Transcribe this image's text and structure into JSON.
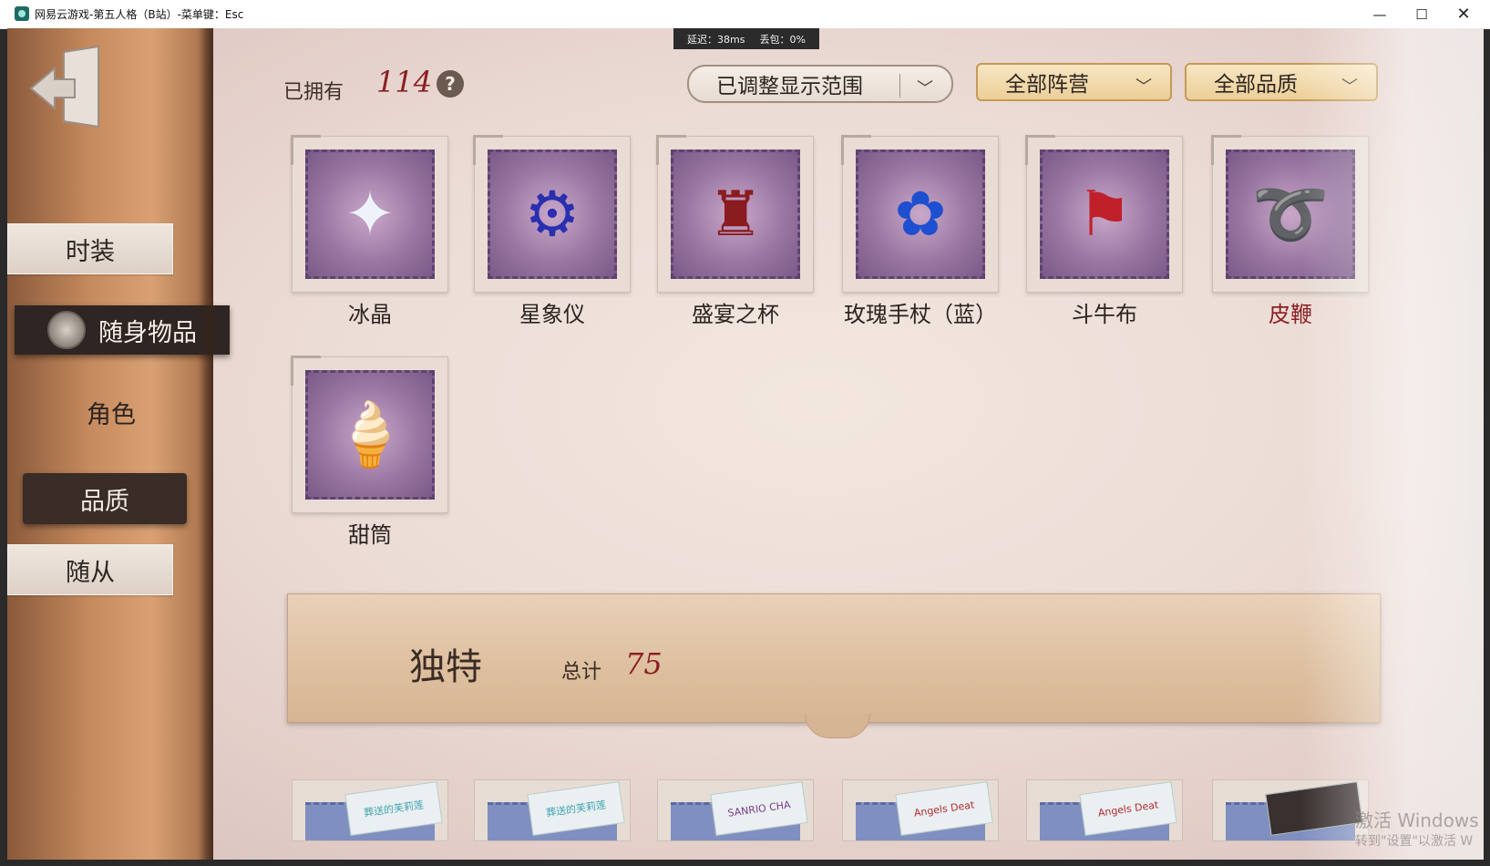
{
  "window": {
    "title": "网易云游戏-第五人格（B站）-菜单键：Esc",
    "minimize": "—",
    "maximize": "☐",
    "close": "✕"
  },
  "netstat": {
    "latency": "延迟：38ms",
    "packet_loss": "丢包：0%"
  },
  "sidebar": {
    "items": [
      {
        "label": "时装"
      },
      {
        "label": "随身物品"
      },
      {
        "label": "角色"
      },
      {
        "label": "品质"
      },
      {
        "label": "随从"
      }
    ]
  },
  "header": {
    "owned_label": "已拥有",
    "owned_count": "114",
    "help_glyph": "?",
    "filters": [
      {
        "label": "已调整显示范围"
      },
      {
        "label": "全部阵营"
      },
      {
        "label": "全部品质"
      }
    ]
  },
  "items": [
    {
      "name": "冰晶",
      "icon": "crystal-icon",
      "color": "#2c2420"
    },
    {
      "name": "星象仪",
      "icon": "astrolabe-icon",
      "color": "#2c2420"
    },
    {
      "name": "盛宴之杯",
      "icon": "goblet-icon",
      "color": "#2c2420"
    },
    {
      "name": "玫瑰手杖（蓝）",
      "icon": "rose-cane-icon",
      "color": "#2c2420"
    },
    {
      "name": "斗牛布",
      "icon": "bullfight-cape-icon",
      "color": "#2c2420"
    },
    {
      "name": "皮鞭",
      "icon": "whip-icon",
      "color": "#8b1f24"
    },
    {
      "name": "甜筒",
      "icon": "ice-cream-icon",
      "color": "#2c2420"
    }
  ],
  "category": {
    "title": "独特",
    "total_label": "总计",
    "total": "75"
  },
  "bottom_cards": [
    {
      "tag": "葬送的芙莉莲"
    },
    {
      "tag": "葬送的芙莉莲"
    },
    {
      "tag": "SANRIO CHA"
    },
    {
      "tag": "Angels Deat"
    },
    {
      "tag": "Angels Deat"
    },
    {
      "tag": ""
    }
  ],
  "watermark": {
    "line1": "激活 Windows",
    "line2": "转到\"设置\"以激活 W"
  },
  "colors": {
    "accent_red": "#8b1f24",
    "nav_active": "#2f2522",
    "gold_filter": "#eccf98"
  }
}
